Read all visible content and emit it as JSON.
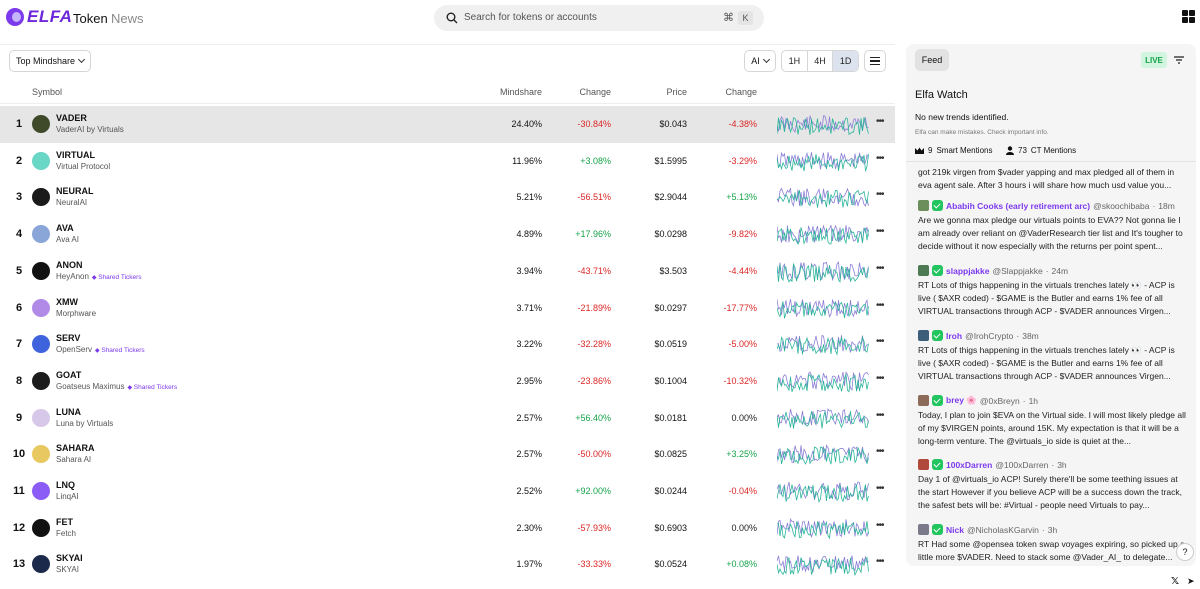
{
  "header": {
    "logo_text": "ELFA",
    "nav": [
      {
        "label": "Token"
      },
      {
        "label": "News"
      }
    ],
    "search": {
      "placeholder": "Search for tokens or accounts",
      "shortcut_cmd": "⌘",
      "shortcut_key": "K"
    }
  },
  "toolbar": {
    "sort_label": "Top Mindshare",
    "category": "AI",
    "timeframes": [
      {
        "label": "1H"
      },
      {
        "label": "4H"
      },
      {
        "label": "1D"
      }
    ],
    "active_timeframe": "1D"
  },
  "table": {
    "columns": {
      "symbol": "Symbol",
      "mindshare": "Mindshare",
      "change": "Change",
      "price": "Price",
      "price_change": "Change"
    },
    "shared_label": "Shared Tickers",
    "rows": [
      {
        "rank": "1",
        "symbol": "VADER",
        "name": "VaderAI by Virtuals",
        "shared": false,
        "mindshare": "24.40%",
        "change": "-30.84%",
        "price": "$0.043",
        "price_change": "-4.38%",
        "icon_color": "#3f4a2a",
        "highlight": true
      },
      {
        "rank": "2",
        "symbol": "VIRTUAL",
        "name": "Virtual Protocol",
        "shared": false,
        "mindshare": "11.96%",
        "change": "+3.08%",
        "price": "$1.5995",
        "price_change": "-3.29%",
        "icon_color": "#6ad6c6",
        "highlight": false
      },
      {
        "rank": "3",
        "symbol": "NEURAL",
        "name": "NeuralAI",
        "shared": false,
        "mindshare": "5.21%",
        "change": "-56.51%",
        "price": "$2.9044",
        "price_change": "+5.13%",
        "icon_color": "#1a1a1a",
        "highlight": false
      },
      {
        "rank": "4",
        "symbol": "AVA",
        "name": "Ava AI",
        "shared": false,
        "mindshare": "4.89%",
        "change": "+17.96%",
        "price": "$0.0298",
        "price_change": "-9.82%",
        "icon_color": "#8aa5d8",
        "highlight": false
      },
      {
        "rank": "5",
        "symbol": "ANON",
        "name": "HeyAnon",
        "shared": true,
        "mindshare": "3.94%",
        "change": "-43.71%",
        "price": "$3.503",
        "price_change": "-4.44%",
        "icon_color": "#111111",
        "highlight": false
      },
      {
        "rank": "6",
        "symbol": "XMW",
        "name": "Morphware",
        "shared": false,
        "mindshare": "3.71%",
        "change": "-21.89%",
        "price": "$0.0297",
        "price_change": "-17.77%",
        "icon_color": "#b18ae8",
        "highlight": false
      },
      {
        "rank": "7",
        "symbol": "SERV",
        "name": "OpenServ",
        "shared": true,
        "mindshare": "3.22%",
        "change": "-32.28%",
        "price": "$0.0519",
        "price_change": "-5.00%",
        "icon_color": "#3e63dd",
        "highlight": false
      },
      {
        "rank": "8",
        "symbol": "GOAT",
        "name": "Goatseus Maximus",
        "shared": true,
        "mindshare": "2.95%",
        "change": "-23.86%",
        "price": "$0.1004",
        "price_change": "-10.32%",
        "icon_color": "#1c1c1c",
        "highlight": false
      },
      {
        "rank": "9",
        "symbol": "LUNA",
        "name": "Luna by Virtuals",
        "shared": false,
        "mindshare": "2.57%",
        "change": "+56.40%",
        "price": "$0.0181",
        "price_change": "0.00%",
        "icon_color": "#d7c7e8",
        "highlight": false
      },
      {
        "rank": "10",
        "symbol": "SAHARA",
        "name": "Sahara AI",
        "shared": false,
        "mindshare": "2.57%",
        "change": "-50.00%",
        "price": "$0.0825",
        "price_change": "+3.25%",
        "icon_color": "#e8c860",
        "highlight": false
      },
      {
        "rank": "11",
        "symbol": "LNQ",
        "name": "LinqAI",
        "shared": false,
        "mindshare": "2.52%",
        "change": "+92.00%",
        "price": "$0.0244",
        "price_change": "-0.04%",
        "icon_color": "#8b5cf6",
        "highlight": false
      },
      {
        "rank": "12",
        "symbol": "FET",
        "name": "Fetch",
        "shared": false,
        "mindshare": "2.30%",
        "change": "-57.93%",
        "price": "$0.6903",
        "price_change": "0.00%",
        "icon_color": "#111111",
        "highlight": false
      },
      {
        "rank": "13",
        "symbol": "SKYAI",
        "name": "SKYAI",
        "shared": false,
        "mindshare": "1.97%",
        "change": "-33.33%",
        "price": "$0.0524",
        "price_change": "+0.08%",
        "icon_color": "#1b2a4a",
        "highlight": false
      }
    ]
  },
  "feed": {
    "tab": "Feed",
    "live": "LIVE",
    "watch_title": "Elfa Watch",
    "watch_text": "No new trends identified.",
    "watch_warning": "Elfa can make mistakes. Check important info.",
    "smart_mentions_count": "9",
    "smart_mentions_label": "Smart Mentions",
    "ct_mentions_count": "73",
    "ct_mentions_label": "CT Mentions",
    "fragment": "got 219k virgen from $vader yapping and max pledged all of them in eva agent sale. After 3 hours i will share how much usd value you...",
    "posts": [
      {
        "name": "Ababih Cooks (early retirement arc)",
        "handle": "@skoochibaba",
        "time": "18m",
        "text": "Are we gonna max pledge our virtuals points to EVA?? Not gonna lie I am already over reliant on @VaderResearch tier list and It's tougher to decide without it now especially with the returns per point spent...",
        "avatar_color": "#6b8e5a"
      },
      {
        "name": "slappjakke",
        "handle": "@Slappjakke",
        "time": "24m",
        "text": "RT Lots of thigs happening in the virtuals trenches lately 👀 - ACP is live ( $AXR coded) - $GAME is the Butler and earns 1% fee of all VIRTUAL transactions through ACP - $VADER announces Virgen...",
        "avatar_color": "#4d7a53"
      },
      {
        "name": "Iroh",
        "handle": "@IrohCrypto",
        "time": "38m",
        "text": "RT Lots of thigs happening in the virtuals trenches lately 👀 - ACP is live ( $AXR coded) - $GAME is the Butler and earns 1% fee of all VIRTUAL transactions through ACP - $VADER announces Virgen...",
        "avatar_color": "#3c5e7a"
      },
      {
        "name": "brey 🌸",
        "handle": "@0xBreyn",
        "time": "1h",
        "text": "Today, I plan to join $EVA on the Virtual side. I will most likely pledge all of my $VIRGEN points, around 15K. My expectation is that it will be a long-term venture. The @virtuals_io side is quiet at the...",
        "avatar_color": "#8d6b5a"
      },
      {
        "name": "100xDarren",
        "handle": "@100xDarren",
        "time": "3h",
        "text": "Day 1 of @virtuals_io ACP! Surely there'll be some teething issues at the start However if you believe ACP will be a success down the track, the safest bets will be: #Virtual - people need Virtuals to pay...",
        "avatar_color": "#b04a3a"
      },
      {
        "name": "Nick",
        "handle": "@NicholasKGarvin",
        "time": "3h",
        "text": "RT Had some @opensea token swap voyages expiring, so picked up a little more $VADER. Need to stack some @Vader_AI_ to delegate...",
        "avatar_color": "#7a7a8a"
      }
    ]
  },
  "footer": {
    "x": "𝕏",
    "telegram": "➤",
    "help": "?"
  }
}
